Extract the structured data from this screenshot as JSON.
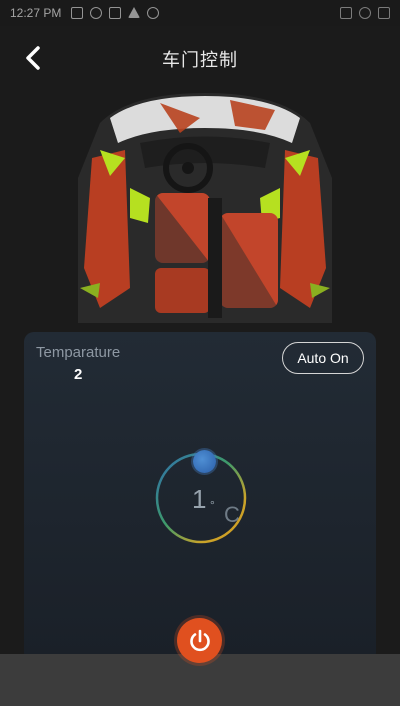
{
  "status_bar": {
    "time": "12:27 PM",
    "left_icons": [
      "message-icon",
      "sync-icon",
      "image-icon",
      "warning-icon",
      "record-icon"
    ],
    "right_icons": [
      "vibrate-icon",
      "wifi-icon",
      "battery-icon"
    ]
  },
  "header": {
    "title": "车门控制",
    "back_icon": "chevron-left-icon"
  },
  "car_view": {
    "image": "car-interior-top-view",
    "seat_color": "#c2452b",
    "accent_color": "#b6e020"
  },
  "temperature_panel": {
    "label": "Temparature",
    "value": "2",
    "auto_button_label": "Auto On",
    "dial_value": "1",
    "dial_unit_symbol": "°",
    "dial_unit": "C"
  },
  "power_button": {
    "icon": "power-icon",
    "color": "#e0501f"
  }
}
